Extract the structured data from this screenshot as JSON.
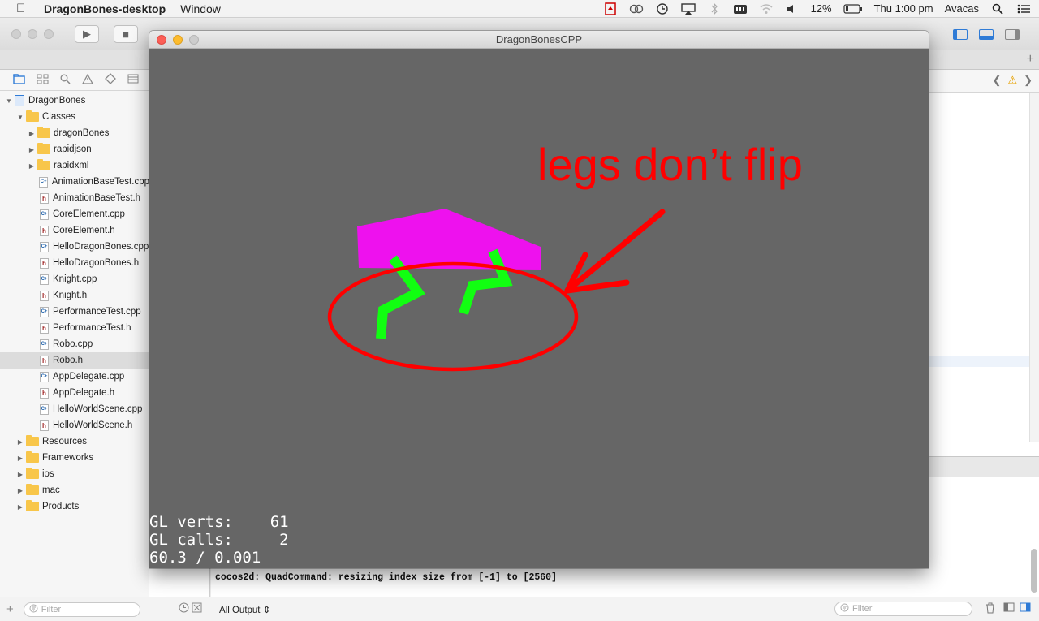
{
  "menubar": {
    "app_name": "DragonBones-desktop",
    "menu_window": "Window",
    "battery": "12%",
    "clock": "Thu 1:00 pm",
    "user": "Avacas"
  },
  "navigator": {
    "items": [
      {
        "label": "DragonBones",
        "kind": "project",
        "indent": 0,
        "expanded": true
      },
      {
        "label": "Classes",
        "kind": "folder",
        "indent": 1,
        "expanded": true
      },
      {
        "label": "dragonBones",
        "kind": "folder",
        "indent": 2,
        "expanded": false
      },
      {
        "label": "rapidjson",
        "kind": "folder",
        "indent": 2,
        "expanded": false
      },
      {
        "label": "rapidxml",
        "kind": "folder",
        "indent": 2,
        "expanded": false
      },
      {
        "label": "AnimationBaseTest.cpp",
        "kind": "cpp",
        "indent": 2
      },
      {
        "label": "AnimationBaseTest.h",
        "kind": "h",
        "indent": 2
      },
      {
        "label": "CoreElement.cpp",
        "kind": "cpp",
        "indent": 2
      },
      {
        "label": "CoreElement.h",
        "kind": "h",
        "indent": 2
      },
      {
        "label": "HelloDragonBones.cpp",
        "kind": "cpp",
        "indent": 2
      },
      {
        "label": "HelloDragonBones.h",
        "kind": "h",
        "indent": 2
      },
      {
        "label": "Knight.cpp",
        "kind": "cpp",
        "indent": 2
      },
      {
        "label": "Knight.h",
        "kind": "h",
        "indent": 2
      },
      {
        "label": "PerformanceTest.cpp",
        "kind": "cpp",
        "indent": 2
      },
      {
        "label": "PerformanceTest.h",
        "kind": "h",
        "indent": 2
      },
      {
        "label": "Robo.cpp",
        "kind": "cpp",
        "indent": 2
      },
      {
        "label": "Robo.h",
        "kind": "h",
        "indent": 2,
        "selected": true
      },
      {
        "label": "AppDelegate.cpp",
        "kind": "cpp",
        "indent": 2
      },
      {
        "label": "AppDelegate.h",
        "kind": "h",
        "indent": 2
      },
      {
        "label": "HelloWorldScene.cpp",
        "kind": "cpp",
        "indent": 2
      },
      {
        "label": "HelloWorldScene.h",
        "kind": "h",
        "indent": 2
      },
      {
        "label": "Resources",
        "kind": "folder",
        "indent": 1,
        "expanded": false
      },
      {
        "label": "Frameworks",
        "kind": "folder",
        "indent": 1,
        "expanded": false
      },
      {
        "label": "ios",
        "kind": "folder",
        "indent": 1,
        "expanded": false
      },
      {
        "label": "mac",
        "kind": "folder",
        "indent": 1,
        "expanded": false
      },
      {
        "label": "Products",
        "kind": "folder",
        "indent": 1,
        "expanded": false
      }
    ],
    "filter_placeholder": "Filter"
  },
  "simulator": {
    "title": "DragonBonesCPP",
    "stats": {
      "verts_label": "GL verts:",
      "verts_value": "61",
      "calls_label": "GL calls:",
      "calls_value": "2",
      "fps_line": "60.3 / 0.001"
    },
    "annotation": "legs don’t flip",
    "colors": {
      "background": "#666666",
      "body": "#ee11ee",
      "legs": "#11ff11",
      "annotation": "#ff0000"
    }
  },
  "console": {
    "line": "cocos2d: QuadCommand: resizing index size from [-1] to [2560]",
    "output_selector": "All Output ⇕",
    "filter_placeholder": "Filter"
  }
}
